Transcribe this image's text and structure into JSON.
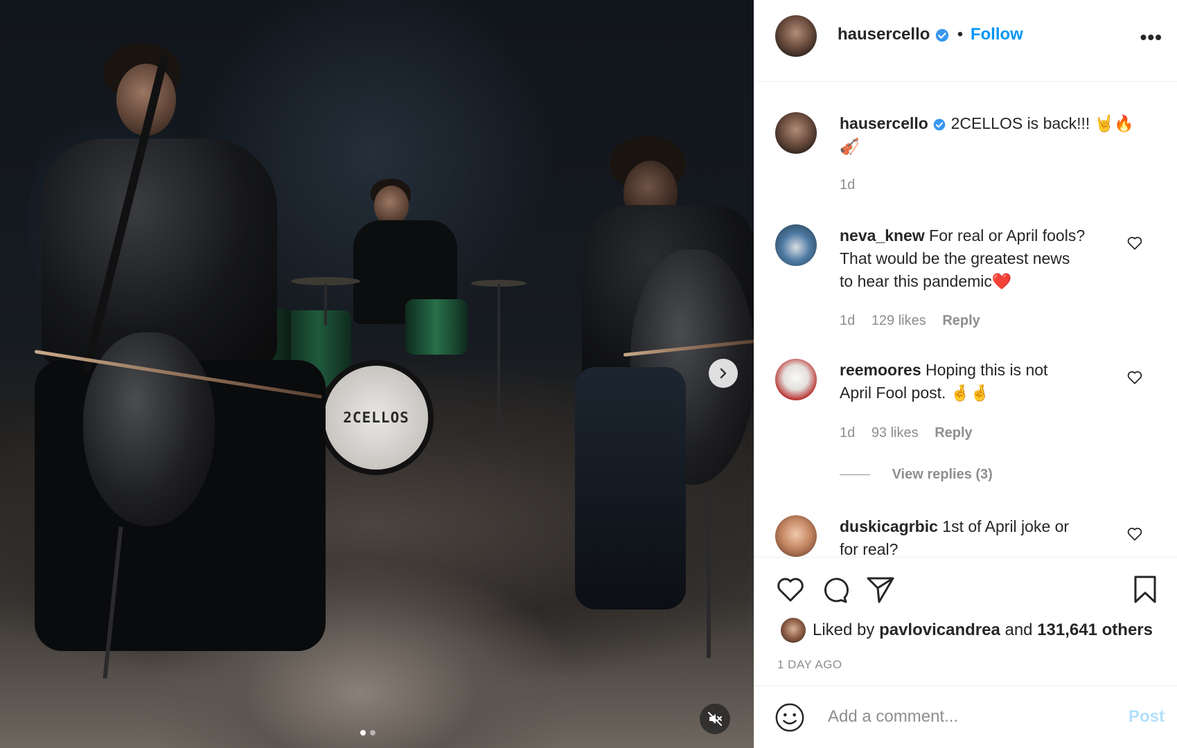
{
  "post": {
    "author": "hausercello",
    "follow_label": "Follow",
    "separator": "•",
    "more_label": "•••",
    "caption_user": "hausercello",
    "caption_text": "2CELLOS is back!!! 🤘🔥",
    "caption_text_line2": "🎻",
    "caption_age": "1d",
    "drum_logo": "2CELLOS",
    "time_ago": "1 DAY AGO"
  },
  "comments": [
    {
      "user": "neva_knew",
      "line1": "For real or April fools?",
      "line2": "That would be the greatest news",
      "line3": "to hear this pandemic❤️",
      "age": "1d",
      "likes": "129 likes",
      "reply": "Reply"
    },
    {
      "user": "reemoores",
      "line1": "Hoping this is not",
      "line2": "April Fool post. 🤞🤞",
      "age": "1d",
      "likes": "93 likes",
      "reply": "Reply",
      "view_replies": "View replies (3)"
    },
    {
      "user": "duskicagrbic",
      "line1": "1st of April joke or",
      "line2": "for real?"
    }
  ],
  "likes": {
    "prefix": "Liked by",
    "user": "pavlovicandrea",
    "middle": "and",
    "others": "131,641 others"
  },
  "add_comment": {
    "placeholder": "Add a comment...",
    "post_label": "Post"
  },
  "colors": {
    "accent": "#0095f6",
    "verified": "#3897f0",
    "muted": "#8e8e8e",
    "text": "#262626",
    "post_disabled": "#b2dffc"
  },
  "carousel": {
    "current": 1,
    "total": 2
  }
}
